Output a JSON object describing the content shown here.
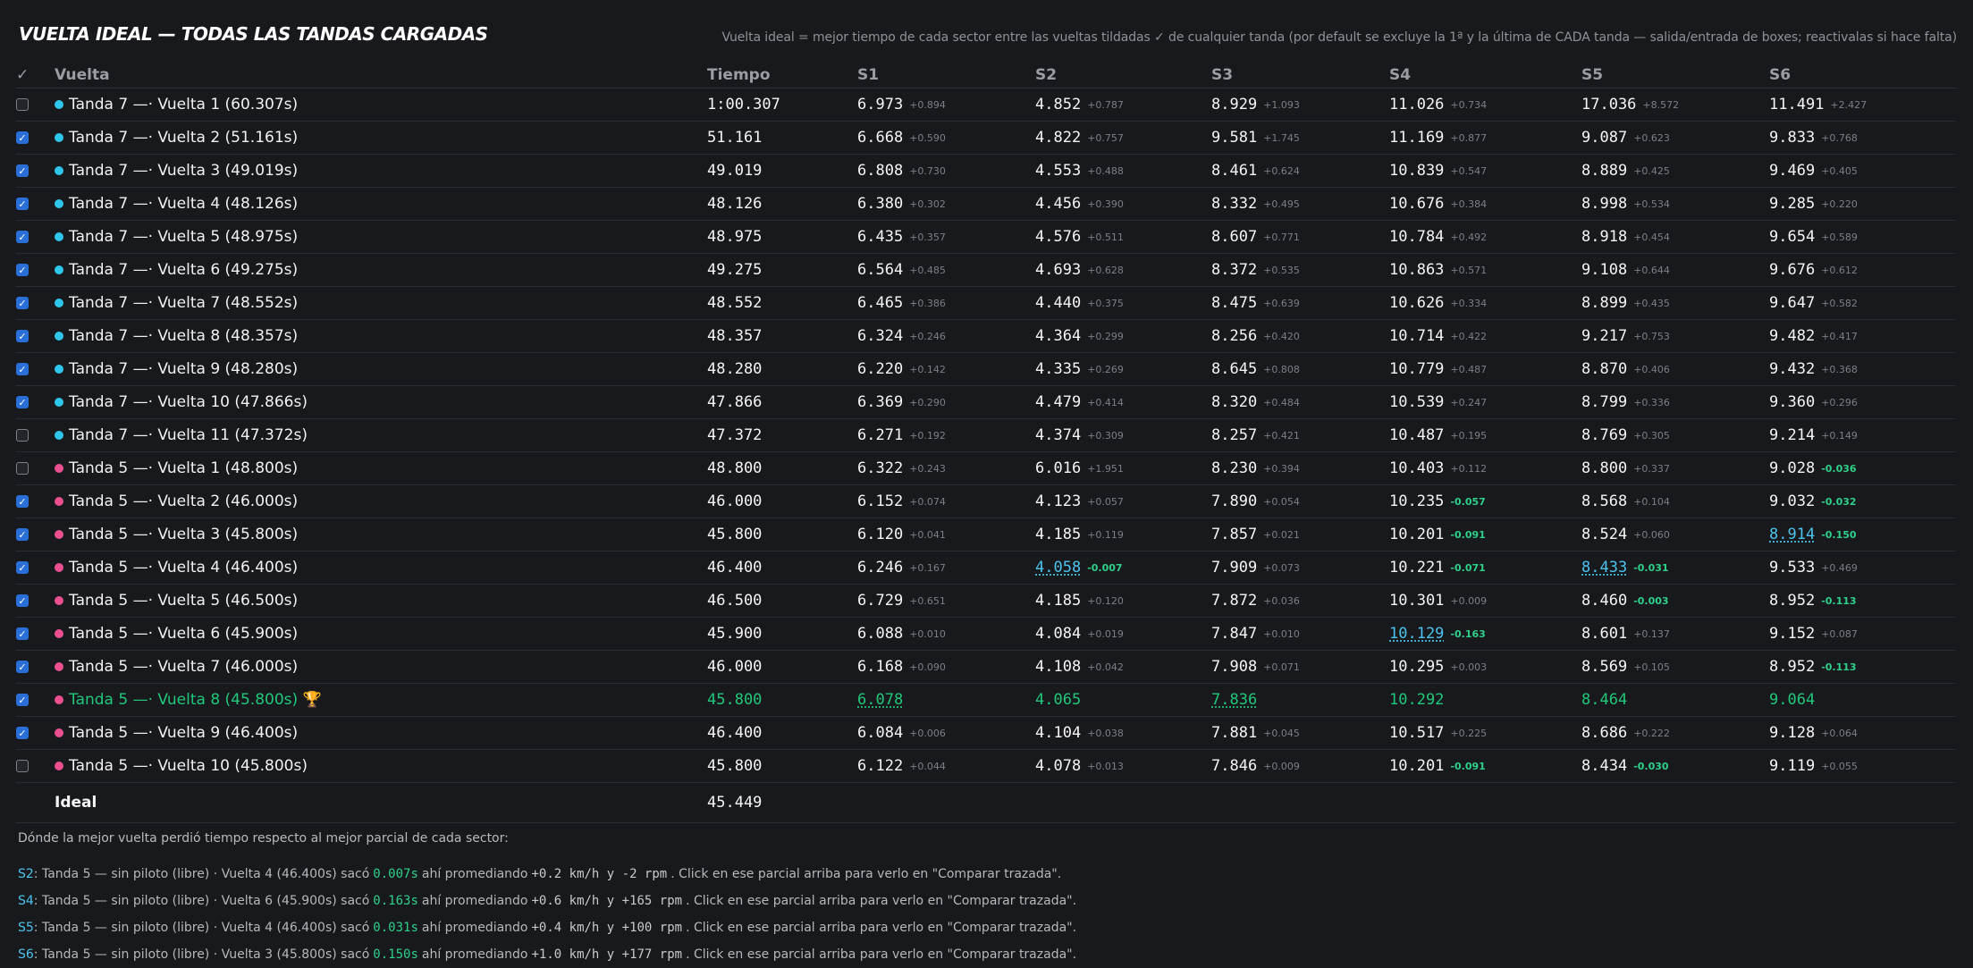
{
  "title": "VUELTA IDEAL — TODAS LAS TANDAS CARGADAS",
  "subtitle": "Vuelta ideal = mejor tiempo de cada sector entre las vueltas tildadas ✓ de cualquier tanda (por default se excluye la 1ª y la última de CADA tanda — salida/entrada de boxes; reactivalas si hace falta)",
  "colors": {
    "tanda7": "#2ec6ea",
    "tanda5": "#ea4f90",
    "best": "#21c87a",
    "link": "#4cc3ee",
    "gain": "#2fd08a"
  },
  "table": {
    "headers": {
      "check": "✓",
      "lap": "Vuelta",
      "time": "Tiempo",
      "s1": "S1",
      "s2": "S2",
      "s3": "S3",
      "s4": "S4",
      "s5": "S5",
      "s6": "S6"
    },
    "rows": [
      {
        "checked": false,
        "tanda": "tanda7",
        "label": "Tanda 7 —· Vuelta 1 (60.307s)",
        "time": "1:00.307",
        "s1": {
          "v": "6.973",
          "d": "+0.894"
        },
        "s2": {
          "v": "4.852",
          "d": "+0.787"
        },
        "s3": {
          "v": "8.929",
          "d": "+1.093"
        },
        "s4": {
          "v": "11.026",
          "d": "+0.734"
        },
        "s5": {
          "v": "17.036",
          "d": "+8.572"
        },
        "s6": {
          "v": "11.491",
          "d": "+2.427"
        }
      },
      {
        "checked": true,
        "tanda": "tanda7",
        "label": "Tanda 7 —· Vuelta 2 (51.161s)",
        "time": "51.161",
        "s1": {
          "v": "6.668",
          "d": "+0.590"
        },
        "s2": {
          "v": "4.822",
          "d": "+0.757"
        },
        "s3": {
          "v": "9.581",
          "d": "+1.745"
        },
        "s4": {
          "v": "11.169",
          "d": "+0.877"
        },
        "s5": {
          "v": "9.087",
          "d": "+0.623"
        },
        "s6": {
          "v": "9.833",
          "d": "+0.768"
        }
      },
      {
        "checked": true,
        "tanda": "tanda7",
        "label": "Tanda 7 —· Vuelta 3 (49.019s)",
        "time": "49.019",
        "s1": {
          "v": "6.808",
          "d": "+0.730"
        },
        "s2": {
          "v": "4.553",
          "d": "+0.488"
        },
        "s3": {
          "v": "8.461",
          "d": "+0.624"
        },
        "s4": {
          "v": "10.839",
          "d": "+0.547"
        },
        "s5": {
          "v": "8.889",
          "d": "+0.425"
        },
        "s6": {
          "v": "9.469",
          "d": "+0.405"
        }
      },
      {
        "checked": true,
        "tanda": "tanda7",
        "label": "Tanda 7 —· Vuelta 4 (48.126s)",
        "time": "48.126",
        "s1": {
          "v": "6.380",
          "d": "+0.302"
        },
        "s2": {
          "v": "4.456",
          "d": "+0.390"
        },
        "s3": {
          "v": "8.332",
          "d": "+0.495"
        },
        "s4": {
          "v": "10.676",
          "d": "+0.384"
        },
        "s5": {
          "v": "8.998",
          "d": "+0.534"
        },
        "s6": {
          "v": "9.285",
          "d": "+0.220"
        }
      },
      {
        "checked": true,
        "tanda": "tanda7",
        "label": "Tanda 7 —· Vuelta 5 (48.975s)",
        "time": "48.975",
        "s1": {
          "v": "6.435",
          "d": "+0.357"
        },
        "s2": {
          "v": "4.576",
          "d": "+0.511"
        },
        "s3": {
          "v": "8.607",
          "d": "+0.771"
        },
        "s4": {
          "v": "10.784",
          "d": "+0.492"
        },
        "s5": {
          "v": "8.918",
          "d": "+0.454"
        },
        "s6": {
          "v": "9.654",
          "d": "+0.589"
        }
      },
      {
        "checked": true,
        "tanda": "tanda7",
        "label": "Tanda 7 —· Vuelta 6 (49.275s)",
        "time": "49.275",
        "s1": {
          "v": "6.564",
          "d": "+0.485"
        },
        "s2": {
          "v": "4.693",
          "d": "+0.628"
        },
        "s3": {
          "v": "8.372",
          "d": "+0.535"
        },
        "s4": {
          "v": "10.863",
          "d": "+0.571"
        },
        "s5": {
          "v": "9.108",
          "d": "+0.644"
        },
        "s6": {
          "v": "9.676",
          "d": "+0.612"
        }
      },
      {
        "checked": true,
        "tanda": "tanda7",
        "label": "Tanda 7 —· Vuelta 7 (48.552s)",
        "time": "48.552",
        "s1": {
          "v": "6.465",
          "d": "+0.386"
        },
        "s2": {
          "v": "4.440",
          "d": "+0.375"
        },
        "s3": {
          "v": "8.475",
          "d": "+0.639"
        },
        "s4": {
          "v": "10.626",
          "d": "+0.334"
        },
        "s5": {
          "v": "8.899",
          "d": "+0.435"
        },
        "s6": {
          "v": "9.647",
          "d": "+0.582"
        }
      },
      {
        "checked": true,
        "tanda": "tanda7",
        "label": "Tanda 7 —· Vuelta 8 (48.357s)",
        "time": "48.357",
        "s1": {
          "v": "6.324",
          "d": "+0.246"
        },
        "s2": {
          "v": "4.364",
          "d": "+0.299"
        },
        "s3": {
          "v": "8.256",
          "d": "+0.420"
        },
        "s4": {
          "v": "10.714",
          "d": "+0.422"
        },
        "s5": {
          "v": "9.217",
          "d": "+0.753"
        },
        "s6": {
          "v": "9.482",
          "d": "+0.417"
        }
      },
      {
        "checked": true,
        "tanda": "tanda7",
        "label": "Tanda 7 —· Vuelta 9 (48.280s)",
        "time": "48.280",
        "s1": {
          "v": "6.220",
          "d": "+0.142"
        },
        "s2": {
          "v": "4.335",
          "d": "+0.269"
        },
        "s3": {
          "v": "8.645",
          "d": "+0.808"
        },
        "s4": {
          "v": "10.779",
          "d": "+0.487"
        },
        "s5": {
          "v": "8.870",
          "d": "+0.406"
        },
        "s6": {
          "v": "9.432",
          "d": "+0.368"
        }
      },
      {
        "checked": true,
        "tanda": "tanda7",
        "label": "Tanda 7 —· Vuelta 10 (47.866s)",
        "time": "47.866",
        "s1": {
          "v": "6.369",
          "d": "+0.290"
        },
        "s2": {
          "v": "4.479",
          "d": "+0.414"
        },
        "s3": {
          "v": "8.320",
          "d": "+0.484"
        },
        "s4": {
          "v": "10.539",
          "d": "+0.247"
        },
        "s5": {
          "v": "8.799",
          "d": "+0.336"
        },
        "s6": {
          "v": "9.360",
          "d": "+0.296"
        }
      },
      {
        "checked": false,
        "tanda": "tanda7",
        "label": "Tanda 7 —· Vuelta 11 (47.372s)",
        "time": "47.372",
        "s1": {
          "v": "6.271",
          "d": "+0.192"
        },
        "s2": {
          "v": "4.374",
          "d": "+0.309"
        },
        "s3": {
          "v": "8.257",
          "d": "+0.421"
        },
        "s4": {
          "v": "10.487",
          "d": "+0.195"
        },
        "s5": {
          "v": "8.769",
          "d": "+0.305"
        },
        "s6": {
          "v": "9.214",
          "d": "+0.149"
        }
      },
      {
        "checked": false,
        "tanda": "tanda5",
        "label": "Tanda 5 —· Vuelta 1 (48.800s)",
        "time": "48.800",
        "s1": {
          "v": "6.322",
          "d": "+0.243"
        },
        "s2": {
          "v": "6.016",
          "d": "+1.951"
        },
        "s3": {
          "v": "8.230",
          "d": "+0.394"
        },
        "s4": {
          "v": "10.403",
          "d": "+0.112"
        },
        "s5": {
          "v": "8.800",
          "d": "+0.337"
        },
        "s6": {
          "v": "9.028",
          "d": "-0.036"
        }
      },
      {
        "checked": true,
        "tanda": "tanda5",
        "label": "Tanda 5 —· Vuelta 2 (46.000s)",
        "time": "46.000",
        "s1": {
          "v": "6.152",
          "d": "+0.074"
        },
        "s2": {
          "v": "4.123",
          "d": "+0.057"
        },
        "s3": {
          "v": "7.890",
          "d": "+0.054"
        },
        "s4": {
          "v": "10.235",
          "d": "-0.057"
        },
        "s5": {
          "v": "8.568",
          "d": "+0.104"
        },
        "s6": {
          "v": "9.032",
          "d": "-0.032"
        }
      },
      {
        "checked": true,
        "tanda": "tanda5",
        "label": "Tanda 5 —· Vuelta 3 (45.800s)",
        "time": "45.800",
        "s1": {
          "v": "6.120",
          "d": "+0.041"
        },
        "s2": {
          "v": "4.185",
          "d": "+0.119"
        },
        "s3": {
          "v": "7.857",
          "d": "+0.021"
        },
        "s4": {
          "v": "10.201",
          "d": "-0.091"
        },
        "s5": {
          "v": "8.524",
          "d": "+0.060"
        },
        "s6": {
          "v": "8.914",
          "d": "-0.150",
          "link": true
        }
      },
      {
        "checked": true,
        "tanda": "tanda5",
        "label": "Tanda 5 —· Vuelta 4 (46.400s)",
        "time": "46.400",
        "s1": {
          "v": "6.246",
          "d": "+0.167"
        },
        "s2": {
          "v": "4.058",
          "d": "-0.007",
          "link": true
        },
        "s3": {
          "v": "7.909",
          "d": "+0.073"
        },
        "s4": {
          "v": "10.221",
          "d": "-0.071"
        },
        "s5": {
          "v": "8.433",
          "d": "-0.031",
          "link": true
        },
        "s6": {
          "v": "9.533",
          "d": "+0.469"
        }
      },
      {
        "checked": true,
        "tanda": "tanda5",
        "label": "Tanda 5 —· Vuelta 5 (46.500s)",
        "time": "46.500",
        "s1": {
          "v": "6.729",
          "d": "+0.651"
        },
        "s2": {
          "v": "4.185",
          "d": "+0.120"
        },
        "s3": {
          "v": "7.872",
          "d": "+0.036"
        },
        "s4": {
          "v": "10.301",
          "d": "+0.009"
        },
        "s5": {
          "v": "8.460",
          "d": "-0.003"
        },
        "s6": {
          "v": "8.952",
          "d": "-0.113"
        }
      },
      {
        "checked": true,
        "tanda": "tanda5",
        "label": "Tanda 5 —· Vuelta 6 (45.900s)",
        "time": "45.900",
        "s1": {
          "v": "6.088",
          "d": "+0.010"
        },
        "s2": {
          "v": "4.084",
          "d": "+0.019"
        },
        "s3": {
          "v": "7.847",
          "d": "+0.010"
        },
        "s4": {
          "v": "10.129",
          "d": "-0.163",
          "link": true
        },
        "s5": {
          "v": "8.601",
          "d": "+0.137"
        },
        "s6": {
          "v": "9.152",
          "d": "+0.087"
        }
      },
      {
        "checked": true,
        "tanda": "tanda5",
        "label": "Tanda 5 —· Vuelta 7 (46.000s)",
        "time": "46.000",
        "s1": {
          "v": "6.168",
          "d": "+0.090"
        },
        "s2": {
          "v": "4.108",
          "d": "+0.042"
        },
        "s3": {
          "v": "7.908",
          "d": "+0.071"
        },
        "s4": {
          "v": "10.295",
          "d": "+0.003"
        },
        "s5": {
          "v": "8.569",
          "d": "+0.105"
        },
        "s6": {
          "v": "8.952",
          "d": "-0.113"
        }
      },
      {
        "checked": true,
        "tanda": "tanda5",
        "best": true,
        "label": "Tanda 5 —· Vuelta 8 (45.800s) 🏆",
        "time": "45.800",
        "s1": {
          "v": "6.078",
          "d": "",
          "link": true
        },
        "s2": {
          "v": "4.065",
          "d": ""
        },
        "s3": {
          "v": "7.836",
          "d": "",
          "link": true
        },
        "s4": {
          "v": "10.292",
          "d": ""
        },
        "s5": {
          "v": "8.464",
          "d": ""
        },
        "s6": {
          "v": "9.064",
          "d": ""
        }
      },
      {
        "checked": true,
        "tanda": "tanda5",
        "label": "Tanda 5 —· Vuelta 9 (46.400s)",
        "time": "46.400",
        "s1": {
          "v": "6.084",
          "d": "+0.006"
        },
        "s2": {
          "v": "4.104",
          "d": "+0.038"
        },
        "s3": {
          "v": "7.881",
          "d": "+0.045"
        },
        "s4": {
          "v": "10.517",
          "d": "+0.225"
        },
        "s5": {
          "v": "8.686",
          "d": "+0.222"
        },
        "s6": {
          "v": "9.128",
          "d": "+0.064"
        }
      },
      {
        "checked": false,
        "tanda": "tanda5",
        "label": "Tanda 5 —· Vuelta 10 (45.800s)",
        "time": "45.800",
        "s1": {
          "v": "6.122",
          "d": "+0.044"
        },
        "s2": {
          "v": "4.078",
          "d": "+0.013"
        },
        "s3": {
          "v": "7.846",
          "d": "+0.009"
        },
        "s4": {
          "v": "10.201",
          "d": "-0.091"
        },
        "s5": {
          "v": "8.434",
          "d": "-0.030"
        },
        "s6": {
          "v": "9.119",
          "d": "+0.055"
        }
      }
    ],
    "ideal": {
      "label": "Ideal",
      "time": "45.449"
    }
  },
  "notes": {
    "heading": "Dónde la mejor vuelta perdió tiempo respecto al mejor parcial de cada sector:",
    "items": [
      {
        "sector": "S2",
        "text": ": Tanda 5 — sin piloto (libre) · Vuelta 4 (46.400s) sacó",
        "gain": "0.007s",
        "mid": "ahí promediando",
        "stat": "+0.2 km/h y -2 rpm",
        "tail": ". Click en ese parcial arriba para verlo en \"Comparar trazada\"."
      },
      {
        "sector": "S4",
        "text": ": Tanda 5 — sin piloto (libre) · Vuelta 6 (45.900s) sacó",
        "gain": "0.163s",
        "mid": "ahí promediando",
        "stat": "+0.6 km/h y +165 rpm",
        "tail": ". Click en ese parcial arriba para verlo en \"Comparar trazada\"."
      },
      {
        "sector": "S5",
        "text": ": Tanda 5 — sin piloto (libre) · Vuelta 4 (46.400s) sacó",
        "gain": "0.031s",
        "mid": "ahí promediando",
        "stat": "+0.4 km/h y +100 rpm",
        "tail": ". Click en ese parcial arriba para verlo en \"Comparar trazada\"."
      },
      {
        "sector": "S6",
        "text": ": Tanda 5 — sin piloto (libre) · Vuelta 3 (45.800s) sacó",
        "gain": "0.150s",
        "mid": "ahí promediando",
        "stat": "+1.0 km/h y +177 rpm",
        "tail": ". Click en ese parcial arriba para verlo en \"Comparar trazada\"."
      }
    ]
  }
}
